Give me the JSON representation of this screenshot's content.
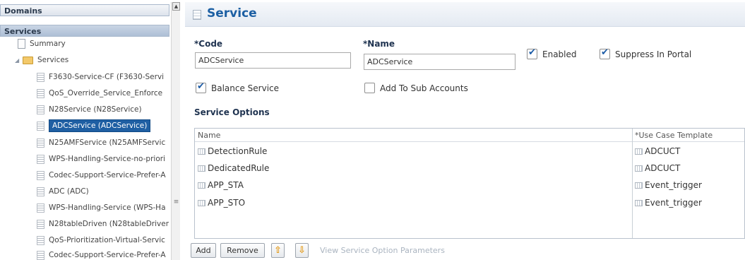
{
  "left": {
    "domains_header": "Domains",
    "services_header": "Services",
    "tree": [
      {
        "label": "Summary",
        "icon": "document-icon",
        "selected": false
      },
      {
        "label": "Services",
        "icon": "folder-icon",
        "selected": false
      },
      {
        "label": "F3630-Service-CF (F3630-Servi",
        "icon": "service-icon",
        "selected": false
      },
      {
        "label": "QoS_Override_Service_Enforce",
        "icon": "service-icon",
        "selected": false
      },
      {
        "label": "N28Service (N28Service)",
        "icon": "service-icon",
        "selected": false
      },
      {
        "label": "ADCService (ADCService)",
        "icon": "service-icon",
        "selected": true
      },
      {
        "label": "N25AMFService (N25AMFServic",
        "icon": "service-icon",
        "selected": false
      },
      {
        "label": "WPS-Handling-Service-no-priori",
        "icon": "service-icon",
        "selected": false
      },
      {
        "label": "Codec-Support-Service-Prefer-A",
        "icon": "service-icon",
        "selected": false
      },
      {
        "label": "ADC (ADC)",
        "icon": "service-icon",
        "selected": false
      },
      {
        "label": "WPS-Handling-Service (WPS-Ha",
        "icon": "service-icon",
        "selected": false
      },
      {
        "label": "N28tableDriven (N28tableDriver",
        "icon": "service-icon",
        "selected": false
      },
      {
        "label": "QoS-Prioritization-Virtual-Servic",
        "icon": "service-icon",
        "selected": false
      },
      {
        "label": "Codec-Support-Service-Prefer-A",
        "icon": "service-icon",
        "selected": false
      }
    ]
  },
  "form": {
    "title": "Service",
    "code_label": "*Code",
    "code_value": "ADCService",
    "name_label": "*Name",
    "name_value": "ADCService",
    "enabled_label": "Enabled",
    "enabled_checked": true,
    "suppress_label": "Suppress In Portal",
    "suppress_checked": true,
    "balance_label": "Balance Service",
    "balance_checked": true,
    "add_sub_label": "Add To Sub Accounts",
    "add_sub_checked": false,
    "options_label": "Service Options"
  },
  "grid": {
    "columns": [
      "Name",
      "*Use Case Template"
    ],
    "rows": [
      {
        "name": "DetectionRule",
        "template": "ADCUCT"
      },
      {
        "name": "DedicatedRule",
        "template": "ADCUCT"
      },
      {
        "name": "APP_STA",
        "template": "Event_trigger"
      },
      {
        "name": "APP_STO",
        "template": "Event_trigger"
      }
    ]
  },
  "toolbar": {
    "add_label": "Add",
    "remove_label": "Remove",
    "up_label": "⇧",
    "down_label": "⇩",
    "view_params_label": "View Service Option Parameters"
  },
  "colors": {
    "title": "#1c5fa3",
    "selection": "#1f5fa3",
    "arrow_buttons": "#e39a1a"
  }
}
